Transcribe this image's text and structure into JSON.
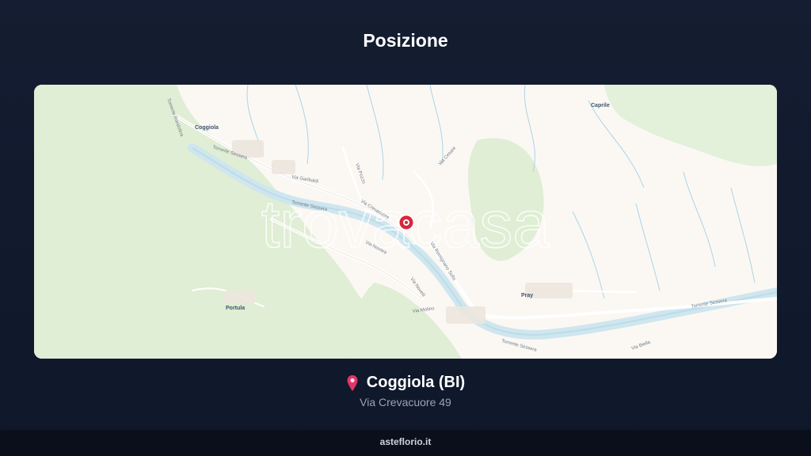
{
  "header": {
    "title": "Posizione"
  },
  "map": {
    "places": {
      "coggiola": "Coggiola",
      "caprile": "Caprile",
      "portula": "Portula",
      "pray": "Pray"
    },
    "roads": {
      "via_garibaldi": "Via Garibaldi",
      "via_crevacuore": "Via Crevacuore",
      "via_novara": "Via Novara",
      "via_novara_2": "Via Novara",
      "via_roma_label": "Via Roma",
      "via_ponte": "Via Pozzo",
      "via_cesare": "Via Cesare",
      "via_valsessera": "Via Valsessera",
      "via_novelli": "Via Novelli",
      "via_molino": "Via Molino",
      "via_biella": "Via Biella",
      "via_mazzini": "Via Mazzini",
      "via_ramignano_sella": "Via Remignano Sella",
      "torrente_sessera": "Torrente Sessera",
      "torrente_sessera_2": "Torrente Sessera",
      "torrente_sessera_3": "Torrente Sessera",
      "torrente_sessera_4": "Torrente Sessera",
      "torrente_rondolina": "Torrente Rondolina",
      "via_casazza": "Via Casazza"
    },
    "watermark": "trovacasa",
    "colors": {
      "land": "#fbf8f4",
      "forest": "#dfeed4",
      "river": "#cfe6ee",
      "stream": "#a9d3e6",
      "road": "#ffffff",
      "marker": "#d7263d"
    }
  },
  "location": {
    "pin_icon": "map-pin-icon",
    "city": "Coggiola (BI)",
    "address": "Via Crevacuore 49"
  },
  "footer": {
    "brand": "asteflorio.it"
  }
}
